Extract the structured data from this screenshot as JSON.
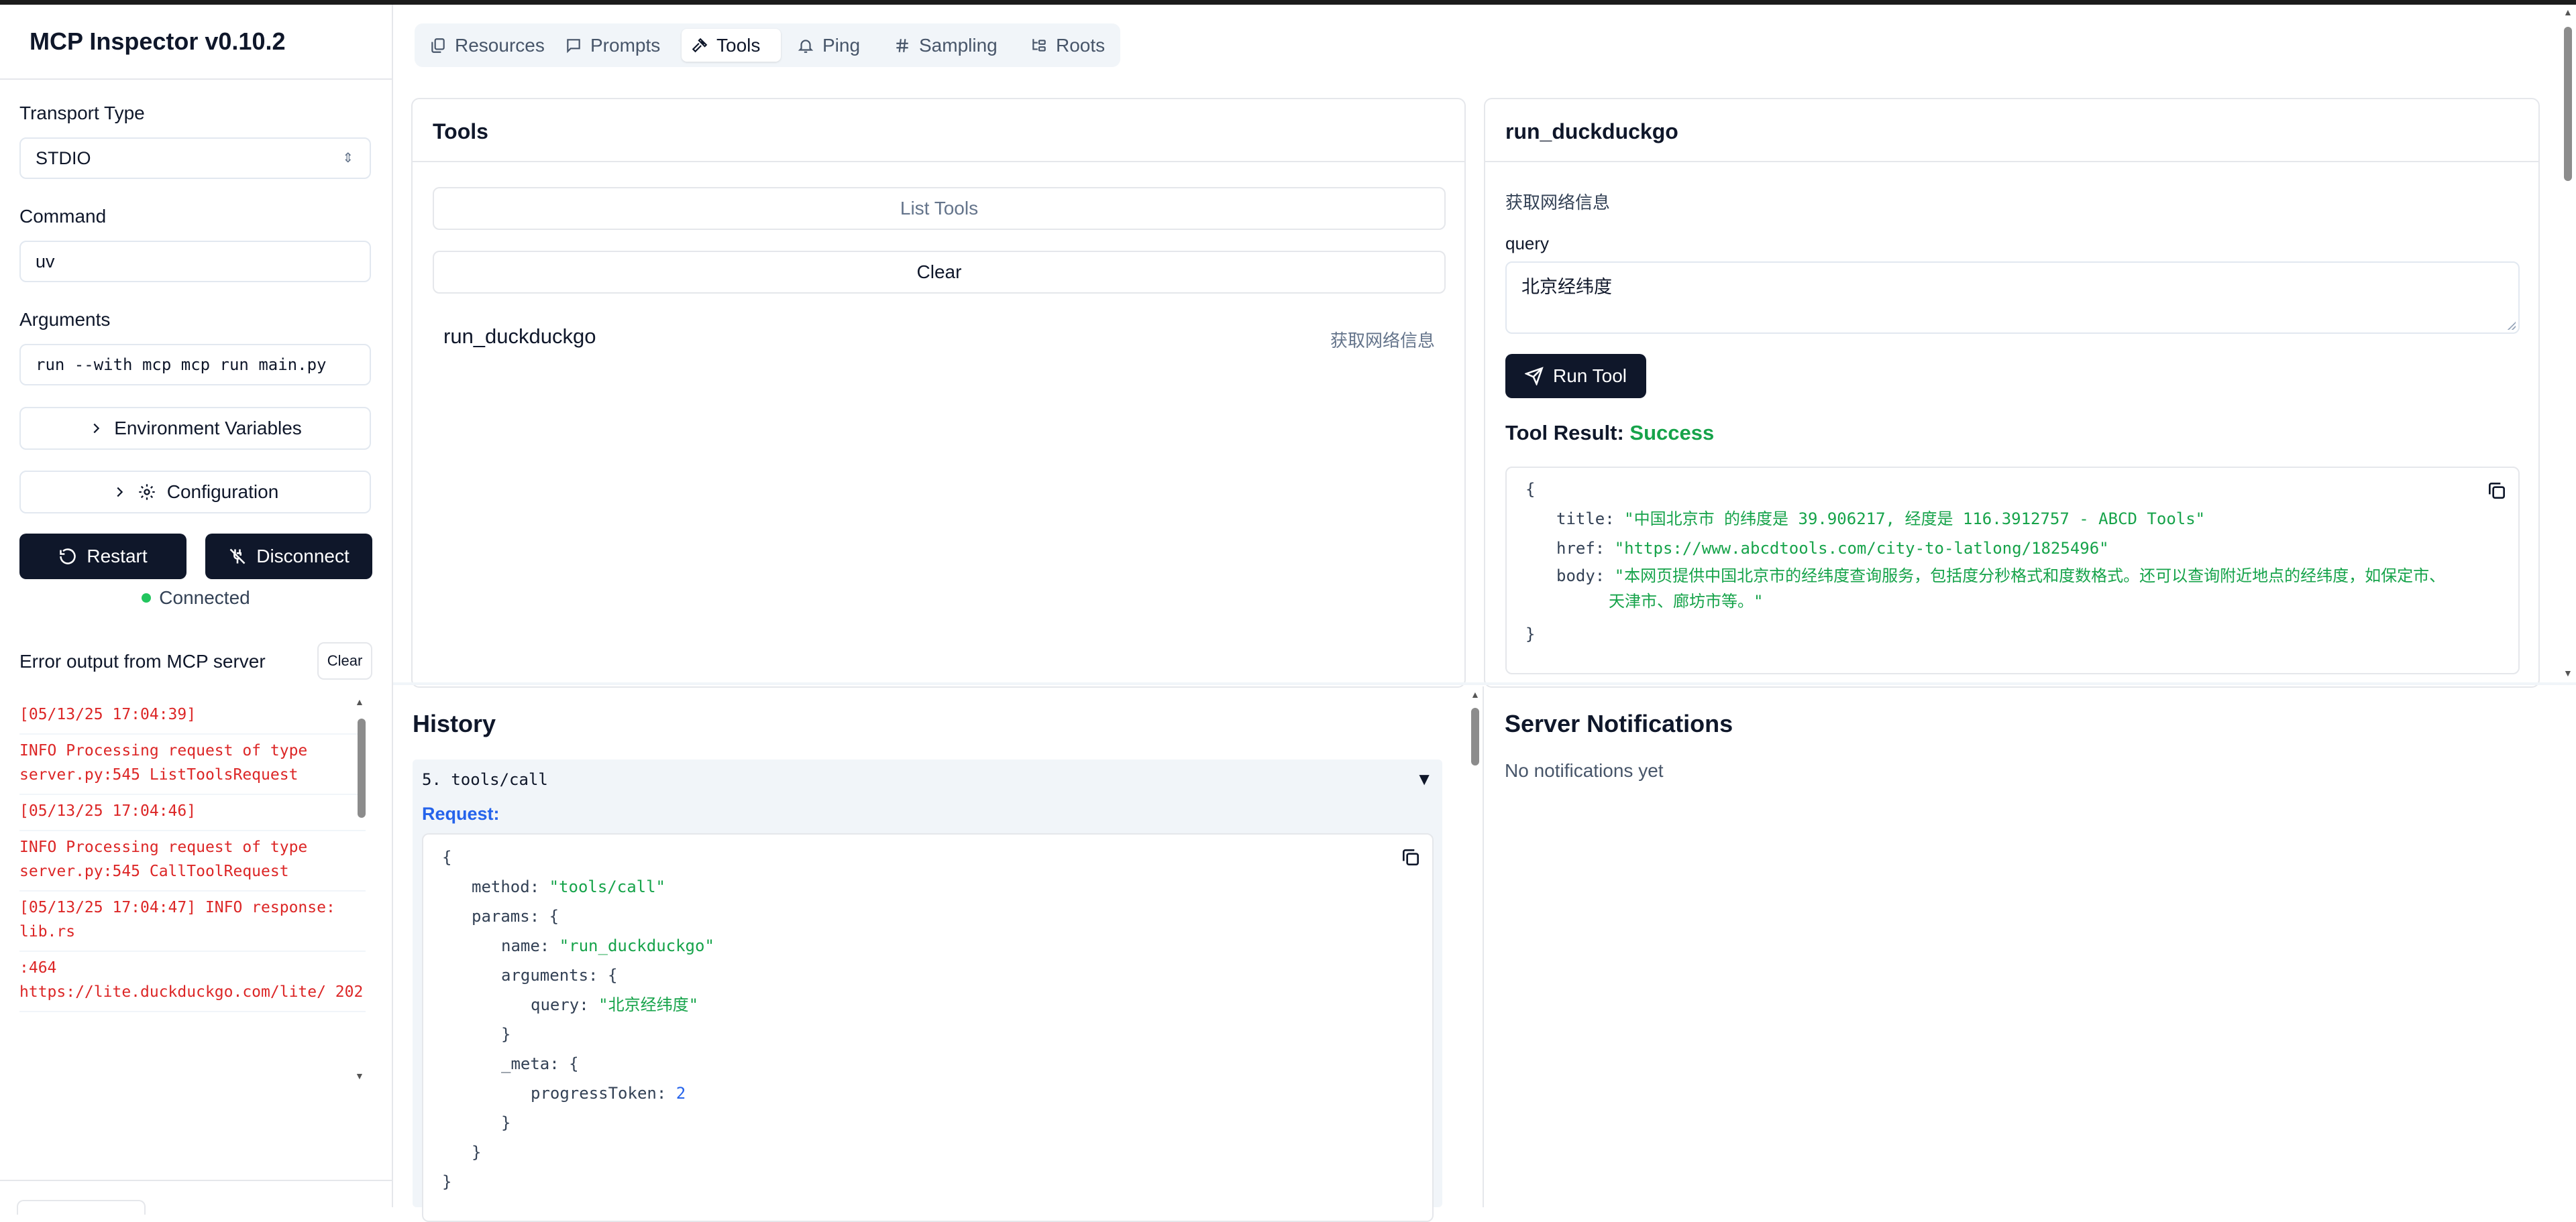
{
  "app": {
    "title": "MCP Inspector v0.10.2"
  },
  "sidebar": {
    "transport_label": "Transport Type",
    "transport_value": "STDIO",
    "command_label": "Command",
    "command_value": "uv",
    "arguments_label": "Arguments",
    "arguments_value": "run --with mcp mcp run main.py",
    "env_button": "Environment Variables",
    "config_button": "Configuration",
    "restart_button": "Restart",
    "disconnect_button": "Disconnect",
    "status": "Connected",
    "status_color": "#22c55e",
    "error_title": "Error output from MCP server",
    "clear_button": "Clear",
    "logs": [
      "[05/13/25 17:04:39]",
      "INFO Processing request of type server.py:545 ListToolsRequest",
      "[05/13/25 17:04:46]",
      "INFO Processing request of type server.py:545 CallToolRequest",
      "[05/13/25 17:04:47] INFO response: lib.rs",
      ":464 https://lite.duckduckgo.com/lite/ 202"
    ]
  },
  "tabs": [
    {
      "label": "Resources",
      "icon": "files-icon"
    },
    {
      "label": "Prompts",
      "icon": "message-icon"
    },
    {
      "label": "Tools",
      "icon": "hammer-icon",
      "active": true
    },
    {
      "label": "Ping",
      "icon": "bell-icon"
    },
    {
      "label": "Sampling",
      "icon": "hash-icon"
    },
    {
      "label": "Roots",
      "icon": "folder-tree-icon"
    }
  ],
  "tools_panel": {
    "title": "Tools",
    "list_button": "List Tools",
    "clear_button": "Clear",
    "tools": [
      {
        "name": "run_duckduckgo",
        "description": "获取网络信息"
      }
    ]
  },
  "tool_detail": {
    "title": "run_duckduckgo",
    "description": "获取网络信息",
    "param_label": "query",
    "param_value": "北京经纬度",
    "run_button": "Run Tool",
    "result_label": "Tool Result:",
    "result_status": "Success",
    "result": {
      "open": "{",
      "close": "}",
      "title_key": "title:",
      "title_val": "\"中国北京市 的纬度是 39.906217, 经度是 116.3912757 - ABCD Tools\"",
      "href_key": "href:",
      "href_val": "\"https://www.abcdtools.com/city-to-latlong/1825496\"",
      "body_key": "body:",
      "body_val_1": "\"本网页提供中国北京市的经纬度查询服务，包括度分秒格式和度数格式。还可以查询附近地点的经纬度，如保定市、",
      "body_val_2": "天津市、廊坊市等。\""
    }
  },
  "history": {
    "title": "History",
    "item_title": "5. tools/call",
    "toggle": "▼",
    "request_label": "Request:",
    "code": {
      "l1": "{",
      "method_key": "method:",
      "method_val": "\"tools/call\"",
      "params_key": "params:",
      "brace_open": "{",
      "name_key": "name:",
      "name_val": "\"run_duckduckgo\"",
      "args_key": "arguments:",
      "query_key": "query:",
      "query_val": "\"北京经纬度\"",
      "close_inner": "}",
      "meta_key": "_meta:",
      "progress_key": "progressToken:",
      "progress_val": "2",
      "close_meta": "}",
      "close_params": "}",
      "close_all": "}"
    }
  },
  "notifications": {
    "title": "Server Notifications",
    "empty": "No notifications yet"
  }
}
